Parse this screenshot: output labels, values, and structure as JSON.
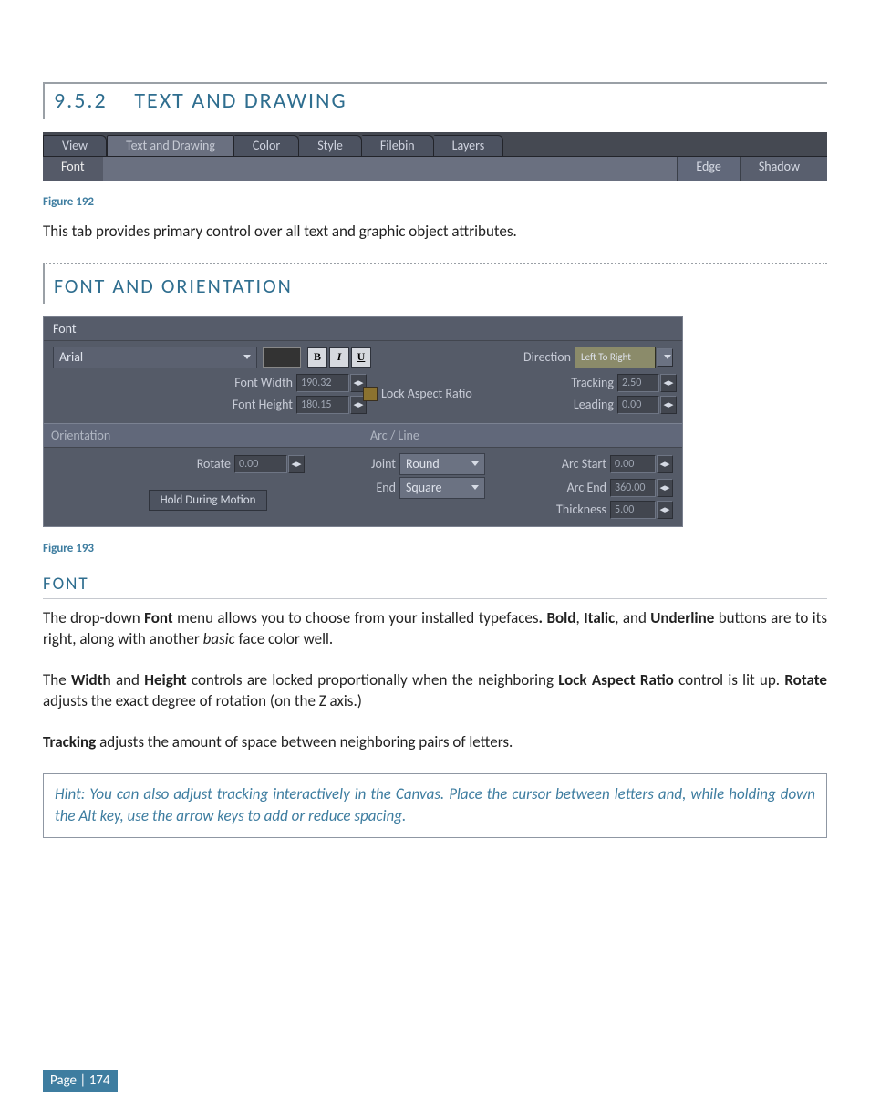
{
  "section": {
    "number": "9.5.2",
    "title": "TEXT AND DRAWING"
  },
  "fig192": {
    "tabs": [
      "View",
      "Text and Drawing",
      "Color",
      "Style",
      "Filebin",
      "Layers"
    ],
    "activeTab": 1,
    "subTabs": [
      "Font",
      "Edge",
      "Shadow"
    ],
    "caption": "Figure 192"
  },
  "para1": "This tab provides primary control over all text and graphic object attributes.",
  "subSection": {
    "title": "FONT AND ORIENTATION"
  },
  "panel": {
    "fontHeader": "Font",
    "fontFamily": "Arial",
    "bold": "B",
    "italic": "I",
    "underline": "U",
    "directionLabel": "Direction",
    "directionValue": "Left To Right",
    "fontWidthLabel": "Font Width",
    "fontWidthValue": "190.32",
    "fontHeightLabel": "Font Height",
    "fontHeightValue": "180.15",
    "lockAspect": "Lock Aspect Ratio",
    "trackingLabel": "Tracking",
    "trackingValue": "2.50",
    "leadingLabel": "Leading",
    "leadingValue": "0.00",
    "orientationHeader": "Orientation",
    "arcHeader": "Arc / Line",
    "rotateLabel": "Rotate",
    "rotateValue": "0.00",
    "holdDuring": "Hold During Motion",
    "jointLabel": "Joint",
    "jointValue": "Round",
    "endLabel": "End",
    "endValue": "Square",
    "arcStartLabel": "Arc Start",
    "arcStartValue": "0.00",
    "arcEndLabel": "Arc End",
    "arcEndValue": "360.00",
    "thicknessLabel": "Thickness",
    "thicknessValue": "5.00",
    "caption": "Figure 193"
  },
  "fontHeading": "FONT",
  "para2_a": "The drop-down ",
  "para2_b": "Font",
  "para2_c": " menu allows you to choose from your installed typefaces",
  "para2_d": ".  Bold",
  "para2_e": ", ",
  "para2_f": "Italic",
  "para2_g": ", and ",
  "para2_h": "Underline",
  "para2_i": " buttons are to its right, along with another ",
  "para2_j": "basic",
  "para2_k": " face color well.",
  "para3_a": "The ",
  "para3_b": "Width",
  "para3_c": " and ",
  "para3_d": "Height",
  "para3_e": " controls are locked proportionally when the neighboring ",
  "para3_f": "Lock Aspect Ratio",
  "para3_g": " control is lit up. ",
  "para3_h": "Rotate",
  "para3_i": " adjusts the exact degree of rotation (on the Z axis.)",
  "para4_a": "Tracking",
  "para4_b": " adjusts the amount of space between neighboring pairs of letters.",
  "hint": "Hint: You can also adjust tracking interactively in the Canvas.  Place the cursor between letters and, while holding down the Alt key, use the arrow keys to add or reduce spacing.",
  "pageNum": "Page | 174"
}
